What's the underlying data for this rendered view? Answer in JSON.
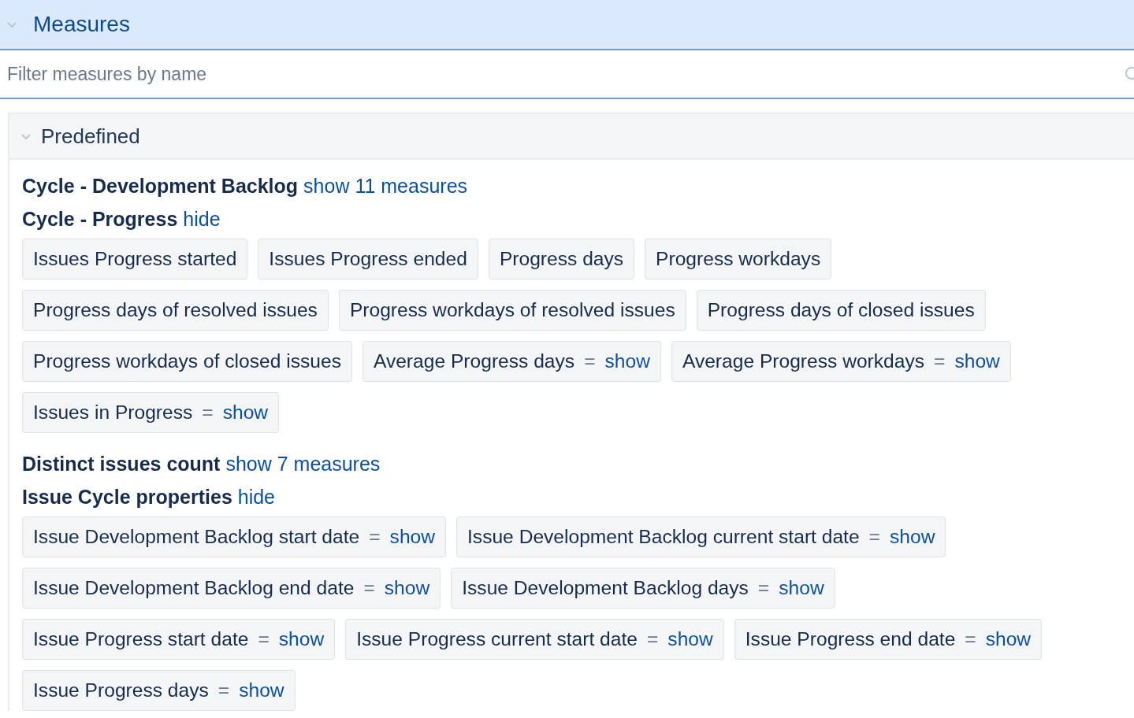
{
  "header": {
    "title": "Measures",
    "expanded": true
  },
  "search": {
    "placeholder": "Filter measures by name"
  },
  "panel": {
    "title": "Predefined",
    "expanded": true,
    "groups": [
      {
        "title": "Cycle - Development Backlog",
        "toggle": "show 11 measures",
        "expanded": false
      },
      {
        "title": "Cycle - Progress",
        "toggle": "hide",
        "expanded": true,
        "measures": [
          {
            "label": "Issues Progress started"
          },
          {
            "label": "Issues Progress ended"
          },
          {
            "label": "Progress days"
          },
          {
            "label": "Progress workdays"
          },
          {
            "label": "Progress days of resolved issues"
          },
          {
            "label": "Progress workdays of resolved issues"
          },
          {
            "label": "Progress days of closed issues"
          },
          {
            "label": "Progress workdays of closed issues"
          },
          {
            "label": "Average Progress days",
            "sign": "=",
            "link": "show"
          },
          {
            "label": "Average Progress workdays",
            "sign": "=",
            "link": "show"
          },
          {
            "label": "Issues in Progress",
            "sign": "=",
            "link": "show"
          }
        ]
      },
      {
        "title": "Distinct issues count",
        "toggle": "show 7 measures",
        "expanded": false
      },
      {
        "title": "Issue Cycle properties",
        "toggle": "hide",
        "expanded": true,
        "measures": [
          {
            "label": "Issue Development Backlog start date",
            "sign": "=",
            "link": "show"
          },
          {
            "label": "Issue Development Backlog current start date",
            "sign": "=",
            "link": "show"
          },
          {
            "label": "Issue Development Backlog end date",
            "sign": "=",
            "link": "show"
          },
          {
            "label": "Issue Development Backlog days",
            "sign": "=",
            "link": "show"
          },
          {
            "label": "Issue Progress start date",
            "sign": "=",
            "link": "show"
          },
          {
            "label": "Issue Progress current start date",
            "sign": "=",
            "link": "show"
          },
          {
            "label": "Issue Progress end date",
            "sign": "=",
            "link": "show"
          },
          {
            "label": "Issue Progress days",
            "sign": "=",
            "link": "show"
          }
        ]
      }
    ]
  }
}
